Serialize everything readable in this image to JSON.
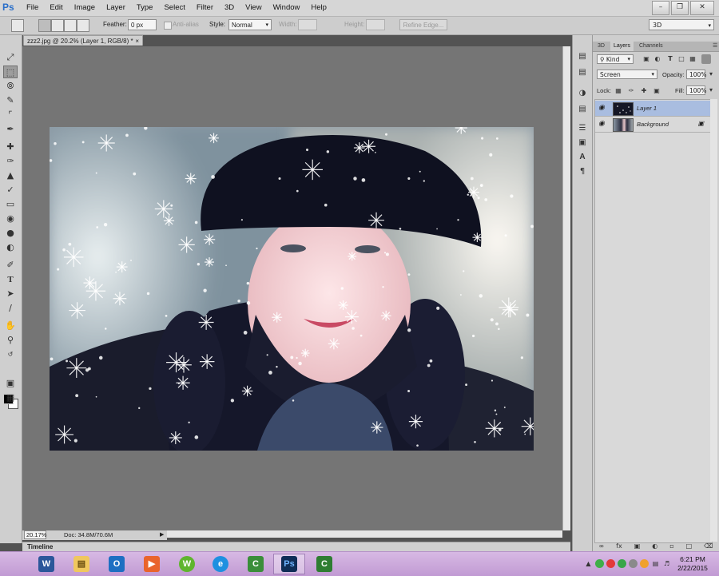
{
  "app": {
    "logo": "Ps",
    "menu": [
      "File",
      "Edit",
      "Image",
      "Layer",
      "Type",
      "Select",
      "Filter",
      "3D",
      "View",
      "Window",
      "Help"
    ],
    "window_buttons": [
      "–",
      "❐",
      "✕"
    ]
  },
  "options_bar": {
    "feather_label": "Feather:",
    "feather_value": "0 px",
    "antialias_label": "Anti-alias",
    "style_label": "Style:",
    "style_value": "Normal",
    "width_label": "Width:",
    "height_label": "Height:",
    "refine_edge_label": "Refine Edge...",
    "workspace_value": "3D"
  },
  "document": {
    "tab_title": "zzz2.jpg @ 20.2% (Layer 1, RGB/8) *",
    "tab_close": "×",
    "zoom": "20.17%",
    "doc_info": "Doc: 34.8M/70.6M"
  },
  "timeline": {
    "label": "Timeline"
  },
  "colors": {
    "foreground": "#000000",
    "background": "#ffffff",
    "selected_layer": "#a9bde0",
    "taskbar": "#c9a6d9"
  },
  "layers_panel": {
    "tabs": [
      "3D",
      "Layers",
      "Channels"
    ],
    "active_tab": "Layers",
    "filter_kind": "Kind",
    "blend_mode": "Screen",
    "opacity_label": "Opacity:",
    "opacity_value": "100%",
    "lock_label": "Lock:",
    "fill_label": "Fill:",
    "fill_value": "100%",
    "layers": [
      {
        "name": "Layer 1",
        "selected": true,
        "locked": false
      },
      {
        "name": "Background",
        "selected": false,
        "locked": true
      }
    ]
  },
  "tools": [
    "move-tool",
    "rectangular-marquee-tool",
    "lasso-tool",
    "quick-selection-tool",
    "crop-tool",
    "eyedropper-tool",
    "spot-healing-tool",
    "brush-tool",
    "clone-stamp-tool",
    "history-brush-tool",
    "eraser-tool",
    "gradient-tool",
    "blur-tool",
    "dodge-tool",
    "pen-tool",
    "type-tool",
    "path-selection-tool",
    "line-tool",
    "hand-tool",
    "zoom-tool"
  ],
  "taskbar": {
    "apps": [
      "word-icon",
      "file-explorer-icon",
      "outlook-icon",
      "media-player-icon",
      "winamp-icon",
      "internet-explorer-icon",
      "camtasia-icon",
      "photoshop-icon",
      "camtasia-recorder-icon"
    ],
    "active_app": "photoshop-icon",
    "clock_time": "6:21 PM",
    "clock_date": "2/22/2015"
  }
}
